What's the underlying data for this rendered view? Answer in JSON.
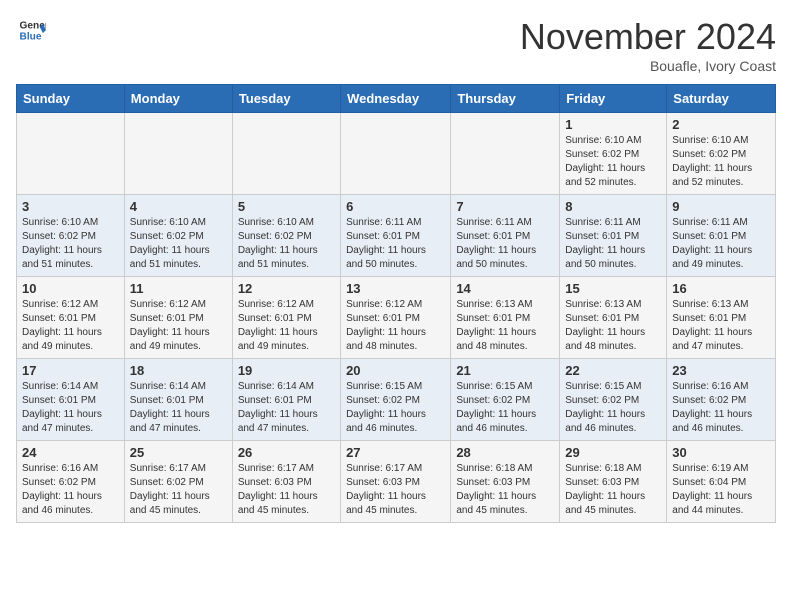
{
  "header": {
    "logo_line1": "General",
    "logo_line2": "Blue",
    "month": "November 2024",
    "location": "Bouafle, Ivory Coast"
  },
  "weekdays": [
    "Sunday",
    "Monday",
    "Tuesday",
    "Wednesday",
    "Thursday",
    "Friday",
    "Saturday"
  ],
  "weeks": [
    [
      {
        "day": "",
        "info": ""
      },
      {
        "day": "",
        "info": ""
      },
      {
        "day": "",
        "info": ""
      },
      {
        "day": "",
        "info": ""
      },
      {
        "day": "",
        "info": ""
      },
      {
        "day": "1",
        "info": "Sunrise: 6:10 AM\nSunset: 6:02 PM\nDaylight: 11 hours\nand 52 minutes."
      },
      {
        "day": "2",
        "info": "Sunrise: 6:10 AM\nSunset: 6:02 PM\nDaylight: 11 hours\nand 52 minutes."
      }
    ],
    [
      {
        "day": "3",
        "info": "Sunrise: 6:10 AM\nSunset: 6:02 PM\nDaylight: 11 hours\nand 51 minutes."
      },
      {
        "day": "4",
        "info": "Sunrise: 6:10 AM\nSunset: 6:02 PM\nDaylight: 11 hours\nand 51 minutes."
      },
      {
        "day": "5",
        "info": "Sunrise: 6:10 AM\nSunset: 6:02 PM\nDaylight: 11 hours\nand 51 minutes."
      },
      {
        "day": "6",
        "info": "Sunrise: 6:11 AM\nSunset: 6:01 PM\nDaylight: 11 hours\nand 50 minutes."
      },
      {
        "day": "7",
        "info": "Sunrise: 6:11 AM\nSunset: 6:01 PM\nDaylight: 11 hours\nand 50 minutes."
      },
      {
        "day": "8",
        "info": "Sunrise: 6:11 AM\nSunset: 6:01 PM\nDaylight: 11 hours\nand 50 minutes."
      },
      {
        "day": "9",
        "info": "Sunrise: 6:11 AM\nSunset: 6:01 PM\nDaylight: 11 hours\nand 49 minutes."
      }
    ],
    [
      {
        "day": "10",
        "info": "Sunrise: 6:12 AM\nSunset: 6:01 PM\nDaylight: 11 hours\nand 49 minutes."
      },
      {
        "day": "11",
        "info": "Sunrise: 6:12 AM\nSunset: 6:01 PM\nDaylight: 11 hours\nand 49 minutes."
      },
      {
        "day": "12",
        "info": "Sunrise: 6:12 AM\nSunset: 6:01 PM\nDaylight: 11 hours\nand 49 minutes."
      },
      {
        "day": "13",
        "info": "Sunrise: 6:12 AM\nSunset: 6:01 PM\nDaylight: 11 hours\nand 48 minutes."
      },
      {
        "day": "14",
        "info": "Sunrise: 6:13 AM\nSunset: 6:01 PM\nDaylight: 11 hours\nand 48 minutes."
      },
      {
        "day": "15",
        "info": "Sunrise: 6:13 AM\nSunset: 6:01 PM\nDaylight: 11 hours\nand 48 minutes."
      },
      {
        "day": "16",
        "info": "Sunrise: 6:13 AM\nSunset: 6:01 PM\nDaylight: 11 hours\nand 47 minutes."
      }
    ],
    [
      {
        "day": "17",
        "info": "Sunrise: 6:14 AM\nSunset: 6:01 PM\nDaylight: 11 hours\nand 47 minutes."
      },
      {
        "day": "18",
        "info": "Sunrise: 6:14 AM\nSunset: 6:01 PM\nDaylight: 11 hours\nand 47 minutes."
      },
      {
        "day": "19",
        "info": "Sunrise: 6:14 AM\nSunset: 6:01 PM\nDaylight: 11 hours\nand 47 minutes."
      },
      {
        "day": "20",
        "info": "Sunrise: 6:15 AM\nSunset: 6:02 PM\nDaylight: 11 hours\nand 46 minutes."
      },
      {
        "day": "21",
        "info": "Sunrise: 6:15 AM\nSunset: 6:02 PM\nDaylight: 11 hours\nand 46 minutes."
      },
      {
        "day": "22",
        "info": "Sunrise: 6:15 AM\nSunset: 6:02 PM\nDaylight: 11 hours\nand 46 minutes."
      },
      {
        "day": "23",
        "info": "Sunrise: 6:16 AM\nSunset: 6:02 PM\nDaylight: 11 hours\nand 46 minutes."
      }
    ],
    [
      {
        "day": "24",
        "info": "Sunrise: 6:16 AM\nSunset: 6:02 PM\nDaylight: 11 hours\nand 46 minutes."
      },
      {
        "day": "25",
        "info": "Sunrise: 6:17 AM\nSunset: 6:02 PM\nDaylight: 11 hours\nand 45 minutes."
      },
      {
        "day": "26",
        "info": "Sunrise: 6:17 AM\nSunset: 6:03 PM\nDaylight: 11 hours\nand 45 minutes."
      },
      {
        "day": "27",
        "info": "Sunrise: 6:17 AM\nSunset: 6:03 PM\nDaylight: 11 hours\nand 45 minutes."
      },
      {
        "day": "28",
        "info": "Sunrise: 6:18 AM\nSunset: 6:03 PM\nDaylight: 11 hours\nand 45 minutes."
      },
      {
        "day": "29",
        "info": "Sunrise: 6:18 AM\nSunset: 6:03 PM\nDaylight: 11 hours\nand 45 minutes."
      },
      {
        "day": "30",
        "info": "Sunrise: 6:19 AM\nSunset: 6:04 PM\nDaylight: 11 hours\nand 44 minutes."
      }
    ]
  ]
}
